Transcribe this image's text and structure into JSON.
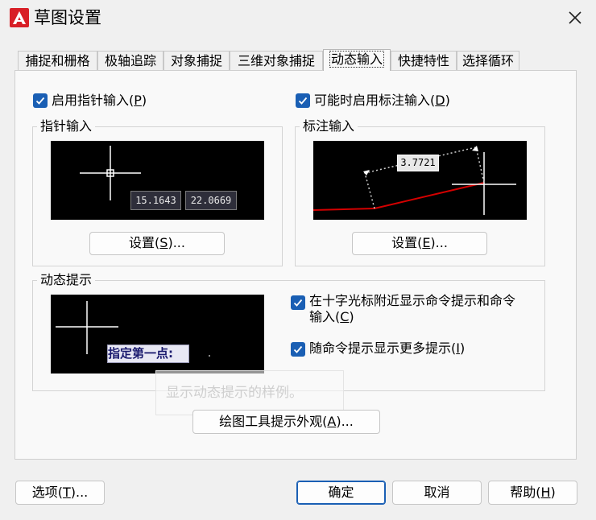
{
  "window": {
    "title": "草图设置",
    "close_label": "✕"
  },
  "tabs": [
    {
      "label": "捕捉和栅格"
    },
    {
      "label": "极轴追踪"
    },
    {
      "label": "对象捕捉"
    },
    {
      "label": "三维对象捕捉"
    },
    {
      "label": "动态输入",
      "active": true
    },
    {
      "label": "快捷特性"
    },
    {
      "label": "选择循环"
    }
  ],
  "pointer": {
    "enable_label": "启用指针输入(",
    "enable_key": "P",
    "enable_suffix": ")",
    "checked": true,
    "group_title": "指针输入",
    "preview_values": [
      "15.1643",
      "22.0669"
    ],
    "settings_label": "设置(",
    "settings_key": "S",
    "settings_suffix": ")..."
  },
  "dimension": {
    "enable_label": "可能时启用标注输入(",
    "enable_key": "D",
    "enable_suffix": ")",
    "checked": true,
    "group_title": "标注输入",
    "preview_value": "3.7721",
    "settings_label": "设置(",
    "settings_key": "E",
    "settings_suffix": ")..."
  },
  "dynamic_prompt": {
    "group_title": "动态提示",
    "preview_prompt": "指定第一点:",
    "option1_line1": "在十字光标附近显示命令提示和命令",
    "option1_line2": "输入(",
    "option1_key": "C",
    "option1_suffix": ")",
    "option1_checked": true,
    "option2_label": "随命令提示显示更多提示(",
    "option2_key": "I",
    "option2_suffix": ")",
    "option2_checked": true,
    "ghost_tooltip": "显示动态提示的样例。"
  },
  "drafting_tooltip_button": {
    "label": "绘图工具提示外观(",
    "key": "A",
    "suffix": ")..."
  },
  "footer": {
    "options_label": "选项(",
    "options_key": "T",
    "options_suffix": ")...",
    "ok_label": "确定",
    "cancel_label": "取消",
    "help_label": "帮助(",
    "help_key": "H",
    "help_suffix": ")"
  },
  "colors": {
    "accent": "#1a5fb4",
    "logo_red": "#d81f26",
    "dim_line_red": "#d40000"
  }
}
